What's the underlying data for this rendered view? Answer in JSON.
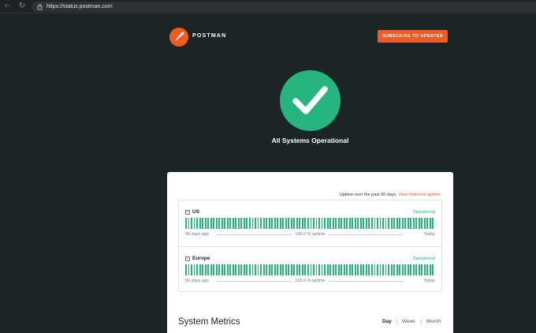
{
  "browser": {
    "url": "https://status.postman.com",
    "icons": {
      "back": "back-arrow-icon",
      "reload": "reload-icon",
      "site_info": "site-info-icon"
    }
  },
  "header": {
    "brand": "POSTMAN",
    "subscribe_label": "SUBSCRIBE TO UPDATES"
  },
  "status": {
    "title": "All Systems Operational",
    "icon": "check-icon"
  },
  "uptime": {
    "caption": "Uptime over the past 90 days.",
    "link": "View historical uptime."
  },
  "components": [
    {
      "name": "US",
      "status": "Operational",
      "start_label": "90 days ago",
      "uptime_label": "100.0 % uptime",
      "end_label": "Today",
      "days": 90
    },
    {
      "name": "Europe",
      "status": "Operational",
      "start_label": "90 days ago",
      "uptime_label": "100.0 % uptime",
      "end_label": "Today",
      "days": 90
    }
  ],
  "metrics": {
    "title": "System Metrics",
    "ranges": [
      {
        "label": "Day",
        "active": true
      },
      {
        "label": "Week",
        "active": false
      },
      {
        "label": "Month",
        "active": false
      }
    ]
  },
  "colors": {
    "page_bg": "#1b2526",
    "accent": "#ef5b25",
    "operational": "#26b47f"
  }
}
